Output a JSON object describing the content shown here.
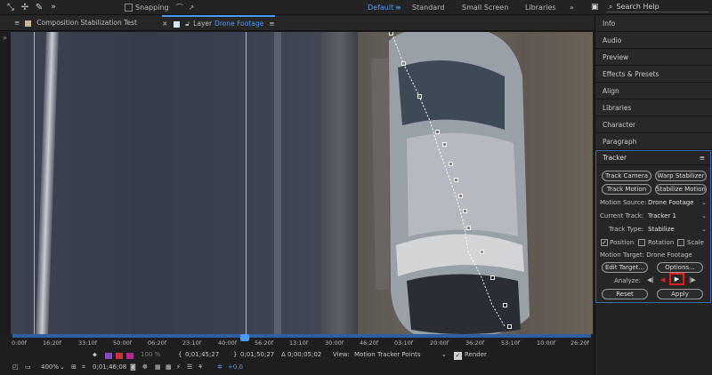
{
  "toolbar": {
    "snapping_label": "Snapping",
    "workspaces": [
      "Default",
      "Standard",
      "Small Screen",
      "Libraries"
    ],
    "active_workspace": "Default",
    "search_placeholder": "Search Help"
  },
  "tabs": {
    "composition_label": "Composition Stabilization Test",
    "layer_prefix": "Layer",
    "layer_name": "Drone Footage"
  },
  "panels": [
    "Info",
    "Audio",
    "Preview",
    "Effects & Presets",
    "Align",
    "Libraries",
    "Character",
    "Paragraph"
  ],
  "tracker": {
    "title": "Tracker",
    "track_camera": "Track Camera",
    "warp_stabilizer": "Warp Stabilizer",
    "track_motion": "Track Motion",
    "stabilize_motion": "Stabilize Motion",
    "motion_source_label": "Motion Source:",
    "motion_source_value": "Drone Footage",
    "current_track_label": "Current Track:",
    "current_track_value": "Tracker 1",
    "track_type_label": "Track Type:",
    "track_type_value": "Stabilize",
    "position_label": "Position",
    "position_checked": true,
    "rotation_label": "Rotation",
    "rotation_checked": false,
    "scale_label": "Scale",
    "scale_checked": false,
    "motion_target_label": "Motion Target: Drone Footage",
    "edit_target": "Edit Target...",
    "options": "Options...",
    "analyze_label": "Analyze:",
    "reset": "Reset",
    "apply": "Apply"
  },
  "timeline_ticks": [
    "0:00f",
    "16:20f",
    "33:10f",
    "50:00f",
    "06:20f",
    "23:10f",
    "40:00f",
    "56:20f",
    "13:10f",
    "30:00f",
    "46:20f",
    "03:10f",
    "20:00f",
    "36:20f",
    "53:10f",
    "10:00f",
    "26:20f"
  ],
  "status": {
    "zoom": "400%",
    "time_code": "0;01;46;08",
    "percent": "100 %",
    "in_point": "0;01;45;27",
    "out_point": "0;01;50;27",
    "duration": "Δ 0;00;05;02",
    "view_label": "View:",
    "view_value": "Motion Tracker Points",
    "render_label": "Render",
    "render_checked": true,
    "exposure": "+0.0"
  },
  "colors": {
    "accent": "#4a9bff",
    "tracker_border": "#3d6aa6",
    "highlight": "#e02020"
  }
}
